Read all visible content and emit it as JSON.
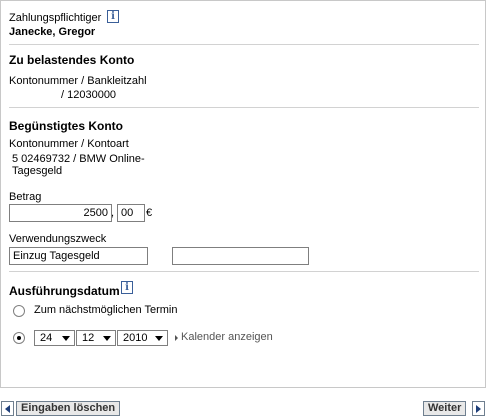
{
  "payer": {
    "label": "Zahlungspflichtiger",
    "name": "Janecke, Gregor",
    "info_icon": "info-icon"
  },
  "debit_account": {
    "heading": "Zu belastendes Konto",
    "label": "Kontonummer / Bankleitzahl",
    "value": "/ 12030000"
  },
  "beneficiary_account": {
    "heading": "Begünstigtes Konto",
    "label": "Kontonummer / Kontoart",
    "line1": "5  02469732 / BMW Online-",
    "line2": "Tagesgeld"
  },
  "amount": {
    "label": "Betrag",
    "euros": "2500",
    "separator": ",",
    "cents": "00",
    "currency": "€"
  },
  "purpose": {
    "label": "Verwendungszweck",
    "line1": "Einzug Tagesgeld",
    "line2": ""
  },
  "execution_date": {
    "heading": "Ausführungsdatum",
    "info_icon": "info-icon",
    "option_next": "Zum nächstmöglichen Termin",
    "selected_option": "date",
    "day": "24",
    "month": "12",
    "year": "2010",
    "calendar_link": "Kalender anzeigen"
  },
  "footer": {
    "reset_label": "Eingaben löschen",
    "next_label": "Weiter"
  },
  "colors": {
    "separator": "#d2d2d2",
    "icon_blue": "#3a5f99",
    "button_bg": "#e8e8e8"
  }
}
